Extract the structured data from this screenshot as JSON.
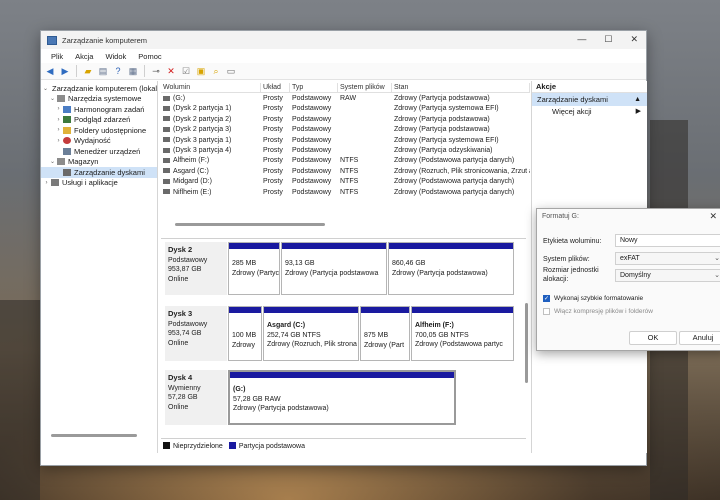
{
  "window": {
    "title": "Zarządzanie komputerem",
    "controls": {
      "minimize": "—",
      "maximize": "☐",
      "close": "✕"
    }
  },
  "menu": [
    "Plik",
    "Akcja",
    "Widok",
    "Pomoc"
  ],
  "toolbar": [
    "back-arrow-icon",
    "forward-arrow-icon",
    "up-folder-icon",
    "show-hide-tree-icon",
    "help-icon",
    "properties-icon",
    "connect-icon",
    "delete-icon",
    "checkmark-icon",
    "export-icon",
    "search-icon",
    "view-icon"
  ],
  "tree": [
    {
      "label": "Zarządzanie komputerem (lokal",
      "arrow": "⌄",
      "depth": 0
    },
    {
      "label": "Narzędzia systemowe",
      "arrow": "⌄",
      "depth": 1
    },
    {
      "label": "Harmonogram zadań",
      "arrow": "›",
      "depth": 2
    },
    {
      "label": "Podgląd zdarzeń",
      "arrow": "›",
      "depth": 2
    },
    {
      "label": "Foldery udostępnione",
      "arrow": "›",
      "depth": 2
    },
    {
      "label": "Wydajność",
      "arrow": "›",
      "depth": 2
    },
    {
      "label": "Menedżer urządzeń",
      "arrow": "",
      "depth": 2
    },
    {
      "label": "Magazyn",
      "arrow": "⌄",
      "depth": 1
    },
    {
      "label": "Zarządzanie dyskami",
      "arrow": "",
      "depth": 2,
      "selected": true
    },
    {
      "label": "Usługi i aplikacje",
      "arrow": "›",
      "depth": 1
    }
  ],
  "volume_columns": [
    "Wolumin",
    "Układ",
    "Typ",
    "System plików",
    "Stan"
  ],
  "volumes": [
    [
      "(G:)",
      "Prosty",
      "Podstawowy",
      "RAW",
      "Zdrowy (Partycja podstawowa)"
    ],
    [
      "(Dysk 2 partycja 1)",
      "Prosty",
      "Podstawowy",
      "",
      "Zdrowy (Partycja systemowa EFI)"
    ],
    [
      "(Dysk 2 partycja 2)",
      "Prosty",
      "Podstawowy",
      "",
      "Zdrowy (Partycja podstawowa)"
    ],
    [
      "(Dysk 2 partycja 3)",
      "Prosty",
      "Podstawowy",
      "",
      "Zdrowy (Partycja podstawowa)"
    ],
    [
      "(Dysk 3 partycja 1)",
      "Prosty",
      "Podstawowy",
      "",
      "Zdrowy (Partycja systemowa EFI)"
    ],
    [
      "(Dysk 3 partycja 4)",
      "Prosty",
      "Podstawowy",
      "",
      "Zdrowy (Partycja odzyskiwania)"
    ],
    [
      "Alfheim (F:)",
      "Prosty",
      "Podstawowy",
      "NTFS",
      "Zdrowy (Podstawowa partycja danych)"
    ],
    [
      "Asgard (C:)",
      "Prosty",
      "Podstawowy",
      "NTFS",
      "Zdrowy (Rozruch, Plik stronicowania, Zrzut awar"
    ],
    [
      "Midgard (D:)",
      "Prosty",
      "Podstawowy",
      "NTFS",
      "Zdrowy (Podstawowa partycja danych)"
    ],
    [
      "Niflheim (E:)",
      "Prosty",
      "Podstawowy",
      "NTFS",
      "Zdrowy (Podstawowa partycja danych)"
    ]
  ],
  "disks": [
    {
      "name": "Dysk 2",
      "type": "Podstawowy",
      "size": "953,87 GB",
      "status": "Online",
      "parts": [
        {
          "l1": "",
          "l2": "285 MB",
          "l3": "Zdrowy (Partyc"
        },
        {
          "l1": "",
          "l2": "93,13 GB",
          "l3": "Zdrowy (Partycja podstawowa"
        },
        {
          "l1": "",
          "l2": "860,46 GB",
          "l3": "Zdrowy (Partycja podstawowa)"
        }
      ]
    },
    {
      "name": "Dysk 3",
      "type": "Podstawowy",
      "size": "953,74 GB",
      "status": "Online",
      "parts": [
        {
          "l1": "",
          "l2": "100 MB",
          "l3": "Zdrowy"
        },
        {
          "l1": "Asgard  (C:)",
          "l2": "252,74 GB NTFS",
          "l3": "Zdrowy (Rozruch, Plik strona"
        },
        {
          "l1": "",
          "l2": "875 MB",
          "l3": "Zdrowy (Part"
        },
        {
          "l1": "Alfheim  (F:)",
          "l2": "700,05 GB NTFS",
          "l3": "Zdrowy (Podstawowa partyc"
        }
      ]
    },
    {
      "name": "Dysk 4",
      "type": "Wymienny",
      "size": "57,28 GB",
      "status": "Online",
      "parts": [
        {
          "l1": "(G:)",
          "l2": "57,28 GB RAW",
          "l3": "Zdrowy (Partycja podstawowa)"
        }
      ]
    }
  ],
  "legend": [
    {
      "label": "Nieprzydzielone",
      "color": "#111111"
    },
    {
      "label": "Partycja podstawowa",
      "color": "#1a1aa0"
    }
  ],
  "actions": {
    "header": "Akcje",
    "section": "Zarządzanie dyskami",
    "more": "Więcej akcji"
  },
  "dialog": {
    "title": "Formatuj G:",
    "close": "✕",
    "label_volume": "Etykieta woluminu:",
    "value_volume": "Nowy",
    "label_fs": "System plików:",
    "value_fs": "exFAT",
    "label_unit": "Rozmiar jednostki alokacji:",
    "value_unit": "Domyślny",
    "quick_format": "Wykonaj szybkie formatowanie",
    "quick_format_checked": true,
    "compression": "Włącz kompresję plików i folderów",
    "compression_checked": false,
    "ok": "OK",
    "cancel": "Anuluj"
  }
}
